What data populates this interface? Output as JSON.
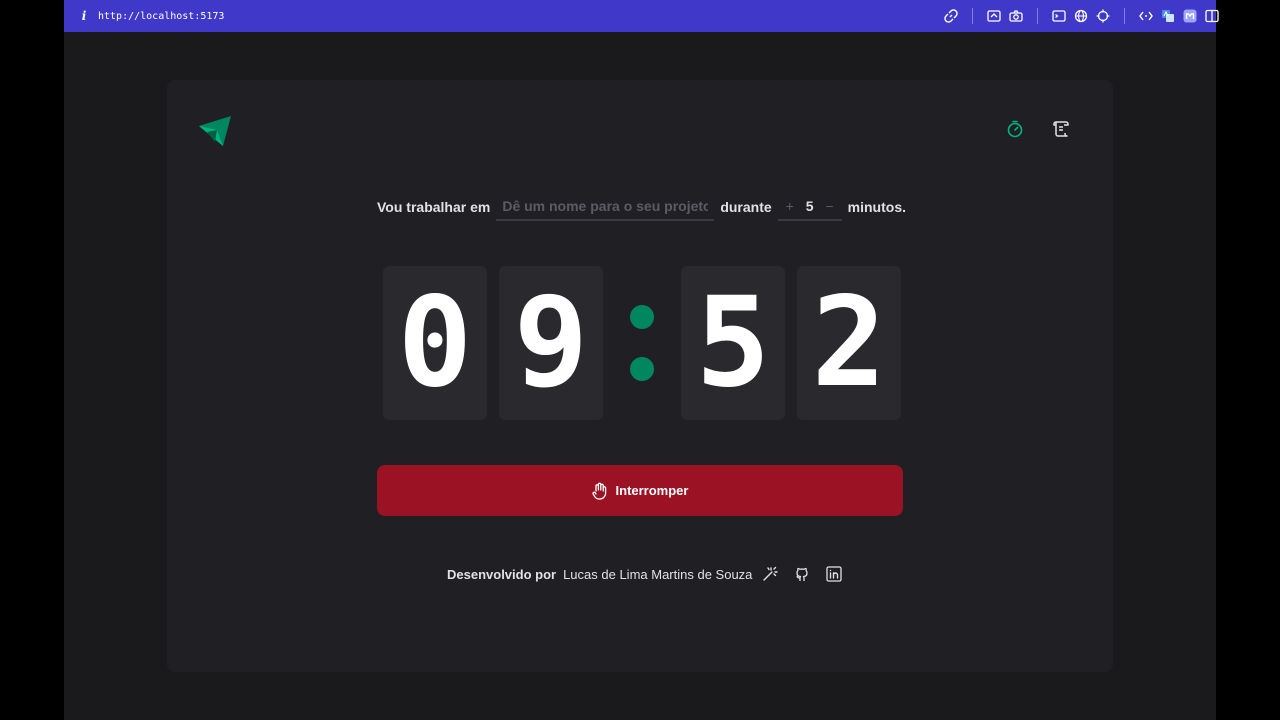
{
  "browser": {
    "url": "http://localhost:5173"
  },
  "colors": {
    "accent": "#00875f",
    "danger": "#9b1225",
    "bar": "#4038c8"
  },
  "nav": {
    "items": [
      "timer-icon",
      "scroll-icon"
    ]
  },
  "form": {
    "prefix": "Vou trabalhar em",
    "task_placeholder": "Dê um nome para o seu projeto",
    "middle": "durante",
    "plus": "+",
    "minutes_value": "5",
    "minus": "−",
    "suffix": "minutos."
  },
  "countdown": {
    "d1": "0",
    "d2": "9",
    "d3": "5",
    "d4": "2"
  },
  "button": {
    "label": "Interromper",
    "icon": "hand-icon"
  },
  "footer": {
    "label": "Desenvolvido por",
    "name": "Lucas de Lima Martins de Souza"
  }
}
